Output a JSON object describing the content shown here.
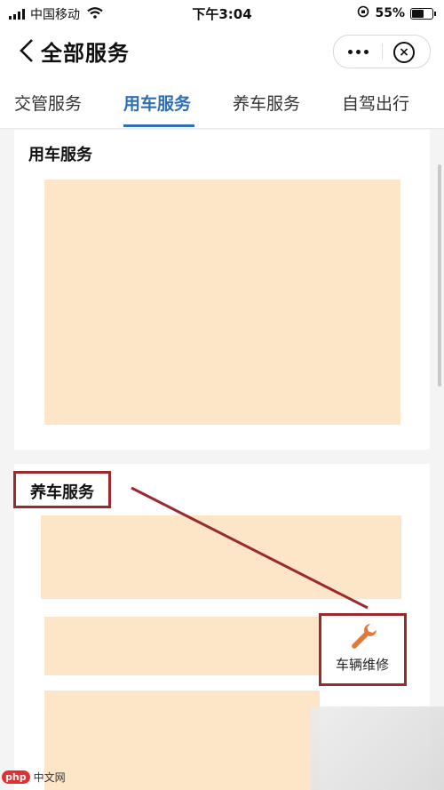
{
  "status_bar": {
    "carrier": "中国移动",
    "time": "下午3:04",
    "battery": "55%"
  },
  "header": {
    "title": "全部服务"
  },
  "tabs": [
    {
      "label": "交管服务",
      "active": false
    },
    {
      "label": "用车服务",
      "active": true
    },
    {
      "label": "养车服务",
      "active": false
    },
    {
      "label": "自驾出行",
      "active": false
    }
  ],
  "sections": [
    {
      "title": "用车服务"
    },
    {
      "title": "养车服务"
    }
  ],
  "repair": {
    "label": "车辆维修",
    "icon": "wrench-icon"
  },
  "watermark": {
    "logo": "php",
    "text": "中文网"
  },
  "colors": {
    "accent": "#2f6fb3",
    "highlight": "#9b2a2f",
    "placeholder": "#fde5c8",
    "icon": "#e07a3c"
  }
}
